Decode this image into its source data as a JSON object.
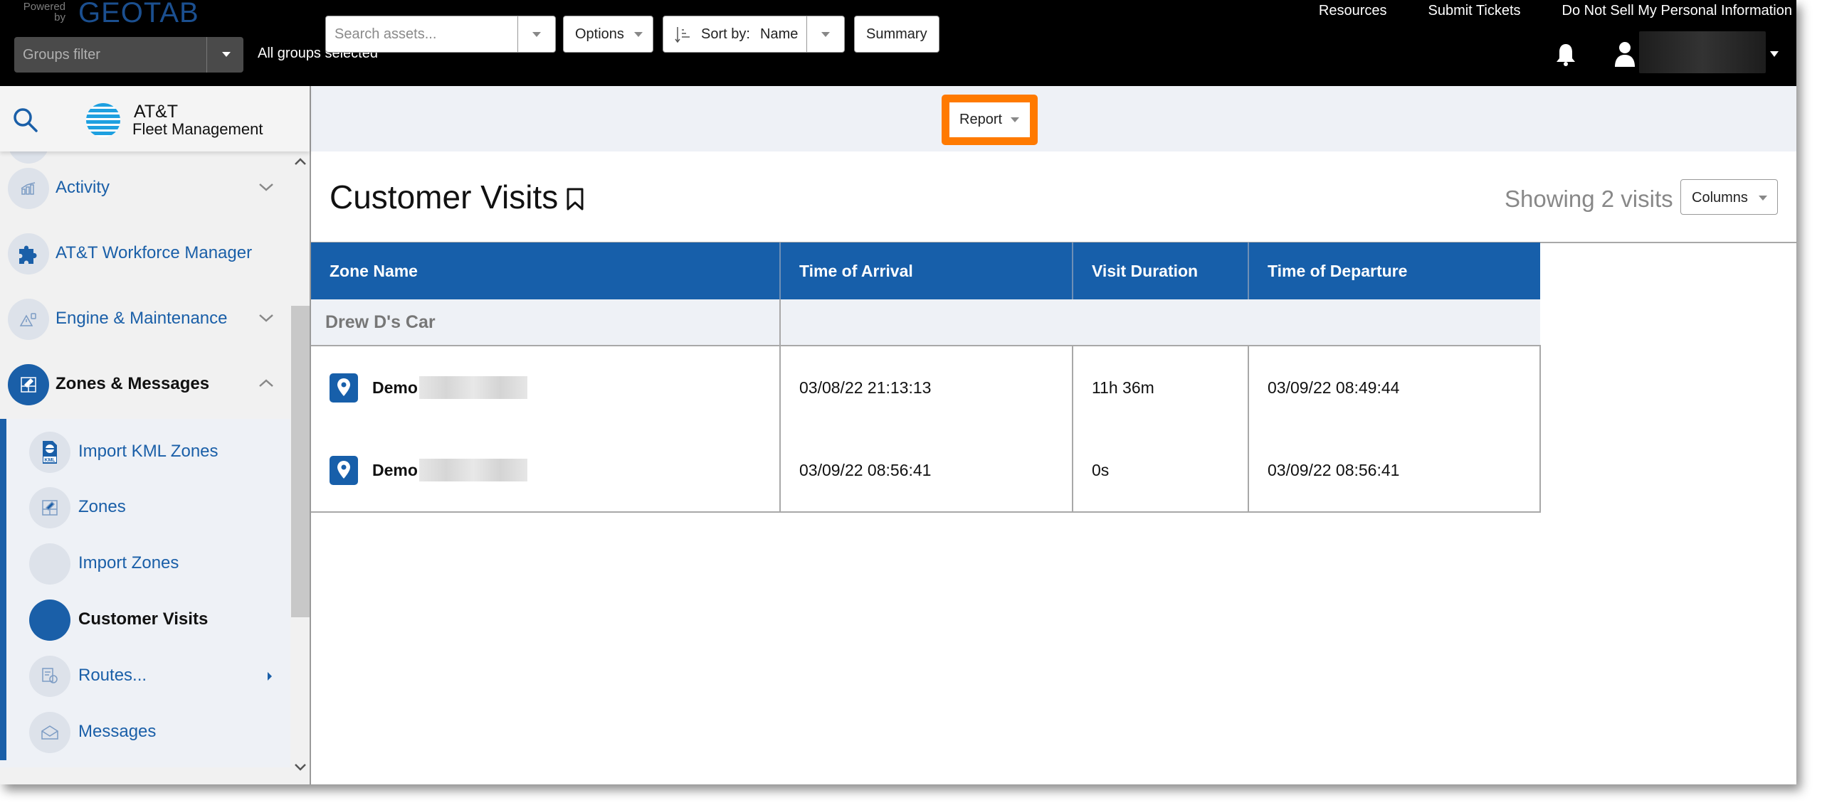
{
  "header": {
    "powered_by": "Powered by",
    "brand": "GEOTAB",
    "groups_filter_placeholder": "Groups filter",
    "groups_status": "All groups selected",
    "links": [
      "Resources",
      "Submit Tickets",
      "Do Not Sell My Personal Information"
    ]
  },
  "sidebar": {
    "brand_line1": "AT&T",
    "brand_line2": "Fleet Management",
    "items": [
      {
        "label": "Activity",
        "icon": "activity-chart-icon",
        "state": "collapsed"
      },
      {
        "label": "AT&T Workforce Manager",
        "icon": "puzzle-piece-icon"
      },
      {
        "label": "Engine & Maintenance",
        "icon": "engine-warning-icon",
        "state": "collapsed"
      },
      {
        "label": "Zones & Messages",
        "icon": "zone-edit-icon",
        "state": "expanded",
        "active": true
      }
    ],
    "sub_items": [
      {
        "label": "Import KML Zones",
        "icon": "kml-file-icon"
      },
      {
        "label": "Zones",
        "icon": "zone-edit-icon"
      },
      {
        "label": "Import Zones",
        "icon": "blank-icon"
      },
      {
        "label": "Customer Visits",
        "icon": "blank-icon",
        "active": true
      },
      {
        "label": "Routes...",
        "icon": "route-icon",
        "has_submenu": true
      },
      {
        "label": "Messages",
        "icon": "envelope-icon"
      }
    ]
  },
  "toolbar": {
    "search_placeholder": "Search assets...",
    "options_label": "Options",
    "sort_prefix": "Sort by:",
    "sort_value": "Name",
    "summary_label": "Summary",
    "report_label": "Report",
    "highlight_color": "#ff7a00"
  },
  "main": {
    "title": "Customer Visits",
    "showing": "Showing 2 visits",
    "columns_label": "Columns"
  },
  "table": {
    "headers": [
      "Zone Name",
      "Time of Arrival",
      "Visit Duration",
      "Time of Departure"
    ],
    "group": "Drew D's Car",
    "rows": [
      {
        "zone": "Demo",
        "arrival": "03/08/22 21:13:13",
        "duration": "11h 36m",
        "departure": "03/09/22 08:49:44"
      },
      {
        "zone": "Demo",
        "arrival": "03/09/22 08:56:41",
        "duration": "0s",
        "departure": "03/09/22 08:56:41"
      }
    ]
  },
  "colors": {
    "accent": "#175faa",
    "header_bg": "#000000",
    "toolbar_bg": "#eef1f6"
  }
}
